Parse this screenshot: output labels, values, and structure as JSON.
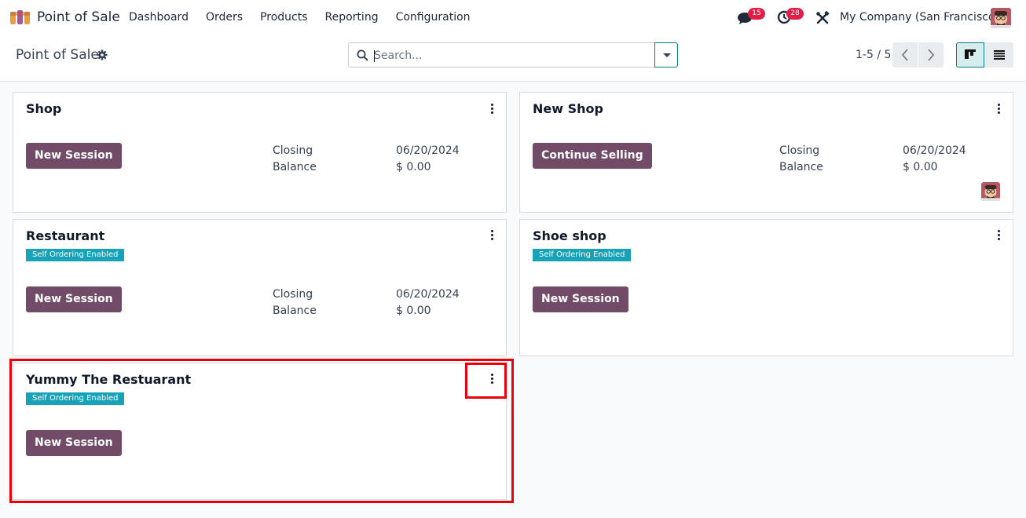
{
  "app": {
    "name": "Point of Sale"
  },
  "menu": [
    "Dashboard",
    "Orders",
    "Products",
    "Reporting",
    "Configuration"
  ],
  "systray": {
    "messages_count": "15",
    "activities_count": "28",
    "company": "My Company (San Francisco)"
  },
  "control_panel": {
    "breadcrumb": "Point of Sale",
    "search_placeholder": "Search...",
    "pager": "1-5 / 5"
  },
  "cards": [
    {
      "title": "Shop",
      "tag": "",
      "button": "New Session",
      "closing_label": "Closing",
      "closing_value": "06/20/2024",
      "balance_label": "Balance",
      "balance_value": "$ 0.00"
    },
    {
      "title": "New Shop",
      "tag": "",
      "button": "Continue Selling",
      "closing_label": "Closing",
      "closing_value": "06/20/2024",
      "balance_label": "Balance",
      "balance_value": "$ 0.00"
    },
    {
      "title": "Restaurant",
      "tag": "Self Ordering Enabled",
      "button": "New Session",
      "closing_label": "Closing",
      "closing_value": "06/20/2024",
      "balance_label": "Balance",
      "balance_value": "$ 0.00"
    },
    {
      "title": "Shoe shop",
      "tag": "Self Ordering Enabled",
      "button": "New Session"
    },
    {
      "title": "Yummy The Restuarant",
      "tag": "Self Ordering Enabled",
      "button": "New Session"
    }
  ],
  "colors": {
    "brand": "#714b67",
    "accent": "#017e84",
    "tag": "#17a2b8",
    "badge": "#e11d48",
    "highlight": "#e8000b"
  },
  "icons": [
    "app-logo-icon",
    "chat-icon",
    "activity-clock-icon",
    "tools-icon",
    "gear-icon",
    "search-icon",
    "chevron-left-icon",
    "chevron-right-icon",
    "kanban-view-icon",
    "list-view-icon",
    "kebab-menu-icon"
  ]
}
